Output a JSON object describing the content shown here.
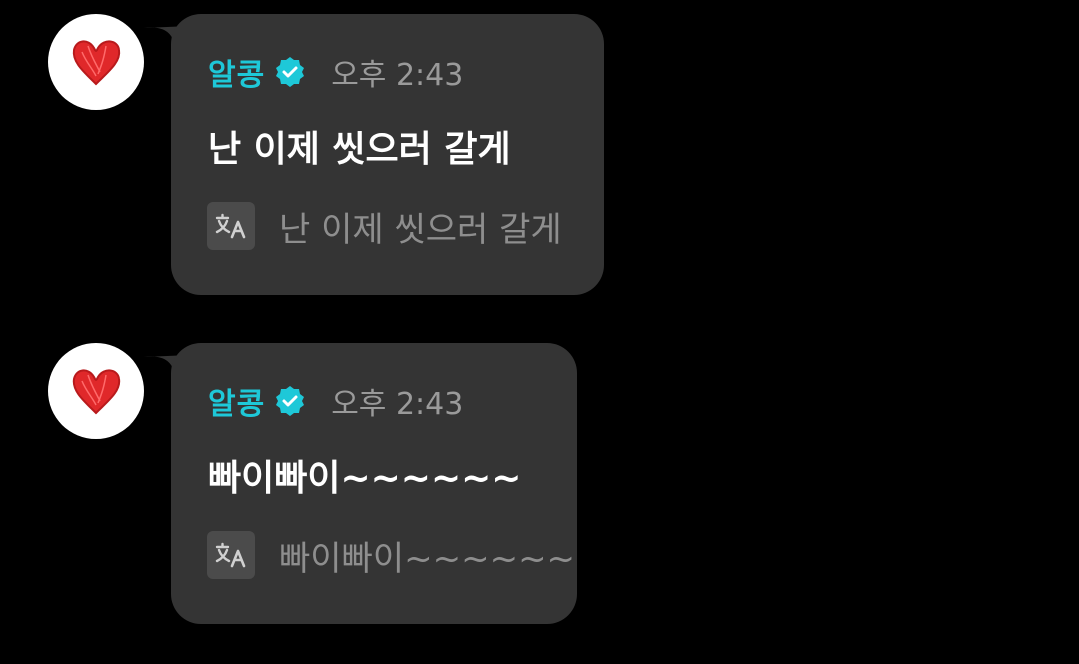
{
  "messages": [
    {
      "sender": "알콩",
      "time": "오후 2:43",
      "text": "난 이제 씻으러 갈게",
      "translation": "난 이제 씻으러 갈게",
      "avatar_icon": "heart-icon",
      "badge_icon": "verified-badge-icon"
    },
    {
      "sender": "알콩",
      "time": "오후 2:43",
      "text": "빠이빠이~~~~~~",
      "translation": "빠이빠이~~~~~~",
      "avatar_icon": "heart-icon",
      "badge_icon": "verified-badge-icon"
    }
  ],
  "colors": {
    "background": "#000000",
    "bubble": "#343434",
    "sender": "#1ec8d8",
    "time": "#9a9a9a",
    "text": "#ffffff",
    "translation": "#8e8e8e",
    "heart": "#e0282a"
  }
}
